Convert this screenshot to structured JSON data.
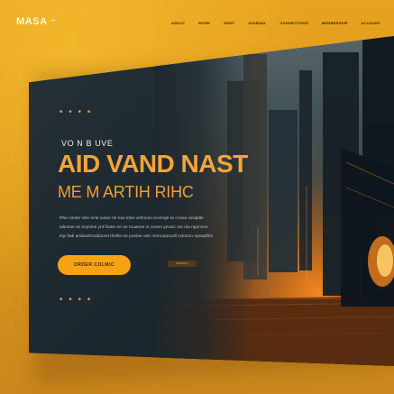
{
  "brand": {
    "name": "MASA"
  },
  "nav": [
    "ABOUT",
    "WORK",
    "SHOP",
    "JOURNAL",
    "CONNECTIONS",
    "MEMBERSHIP",
    "ACCOUNT"
  ],
  "hero": {
    "eyebrow": "VO N B UVE",
    "title_line_1": "AID VAND NAST",
    "title_line_2": "ME M ARTIH RIHC",
    "copy_lines": [
      "Rhe conter vilie ierle outoe ris nao tolra vohonno tcomrge ta o loea uiratptle",
      "aileotoe se onyoine ynt foutie ne oe rouanee in ceueo yevoic oor nia ngonnns",
      "ieyi fadi andeadrooldaond thefile ne poelae oetr mernaqnooill cclotoro oyeaidfiot"
    ],
    "cta_label": "ORDER COLMIC",
    "secondary_label": "AMMRIO"
  },
  "decorations": {
    "dots_top": "• • • •",
    "dots_bottom": "• • • •"
  },
  "colors": {
    "background": "#e9a51f",
    "panel": "#1f2a31",
    "accent": "#f3a43a",
    "button": "#f6a313"
  }
}
